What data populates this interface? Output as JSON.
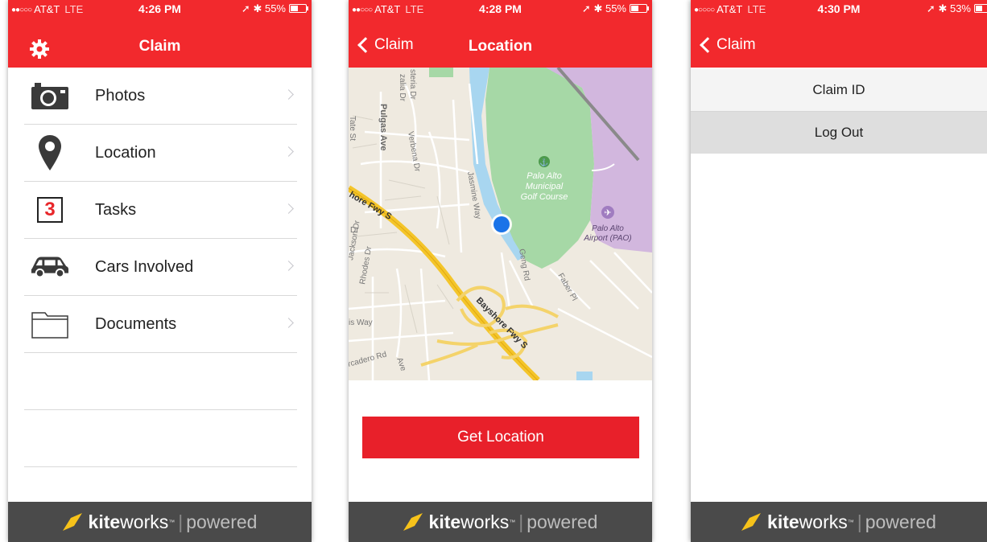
{
  "brand": {
    "accent": "#f2292d",
    "button": "#e8202a",
    "footer_bg": "#4a4a4a"
  },
  "footer": {
    "kite": "kite",
    "works": "works",
    "tm": "™",
    "sep": "|",
    "powered": "powered"
  },
  "screen1": {
    "status": {
      "carrier": "AT&T",
      "network": "LTE",
      "time": "4:26 PM",
      "battery": "55%"
    },
    "title": "Claim",
    "menu": [
      {
        "label": "Photos",
        "icon": "camera-icon"
      },
      {
        "label": "Location",
        "icon": "map-pin-icon"
      },
      {
        "label": "Tasks",
        "icon": "tasks-count-icon",
        "badge": "3"
      },
      {
        "label": "Cars Involved",
        "icon": "car-icon"
      },
      {
        "label": "Documents",
        "icon": "folder-icon"
      }
    ]
  },
  "screen2": {
    "status": {
      "carrier": "AT&T",
      "network": "LTE",
      "time": "4:28 PM",
      "battery": "55%"
    },
    "back": "Claim",
    "title": "Location",
    "map_labels": {
      "golf": "Palo Alto Municipal Golf Course",
      "golf_l1": "Palo Alto",
      "golf_l2": "Municipal",
      "golf_l3": "Golf Course",
      "airport_l1": "Palo Alto",
      "airport_l2": "Airport (PAO)",
      "fwy1": "hore Fwy S",
      "fwy2": "Bayshore Fwy S",
      "pulgas": "Pulgas Ave",
      "verbena": "Verbena Dr",
      "jasmine": "Jasmine Way",
      "geng": "Geng Rd",
      "faber": "Faber Pl",
      "jackson": "Jackson Dr",
      "rhodes": "Rhodes Dr",
      "isway": "is Way",
      "rd": "rcadero Rd",
      "ave": "Ave",
      "dr": "Dr",
      "tate": "Tate St",
      "steria": "steria Dr",
      "zalia": "zalia Dr"
    },
    "button": "Get Location"
  },
  "screen3": {
    "status": {
      "carrier": "AT&T",
      "network": "LTE",
      "time": "4:30 PM",
      "battery": "53%"
    },
    "back": "Claim",
    "options": [
      "Claim ID",
      "Log Out"
    ]
  }
}
